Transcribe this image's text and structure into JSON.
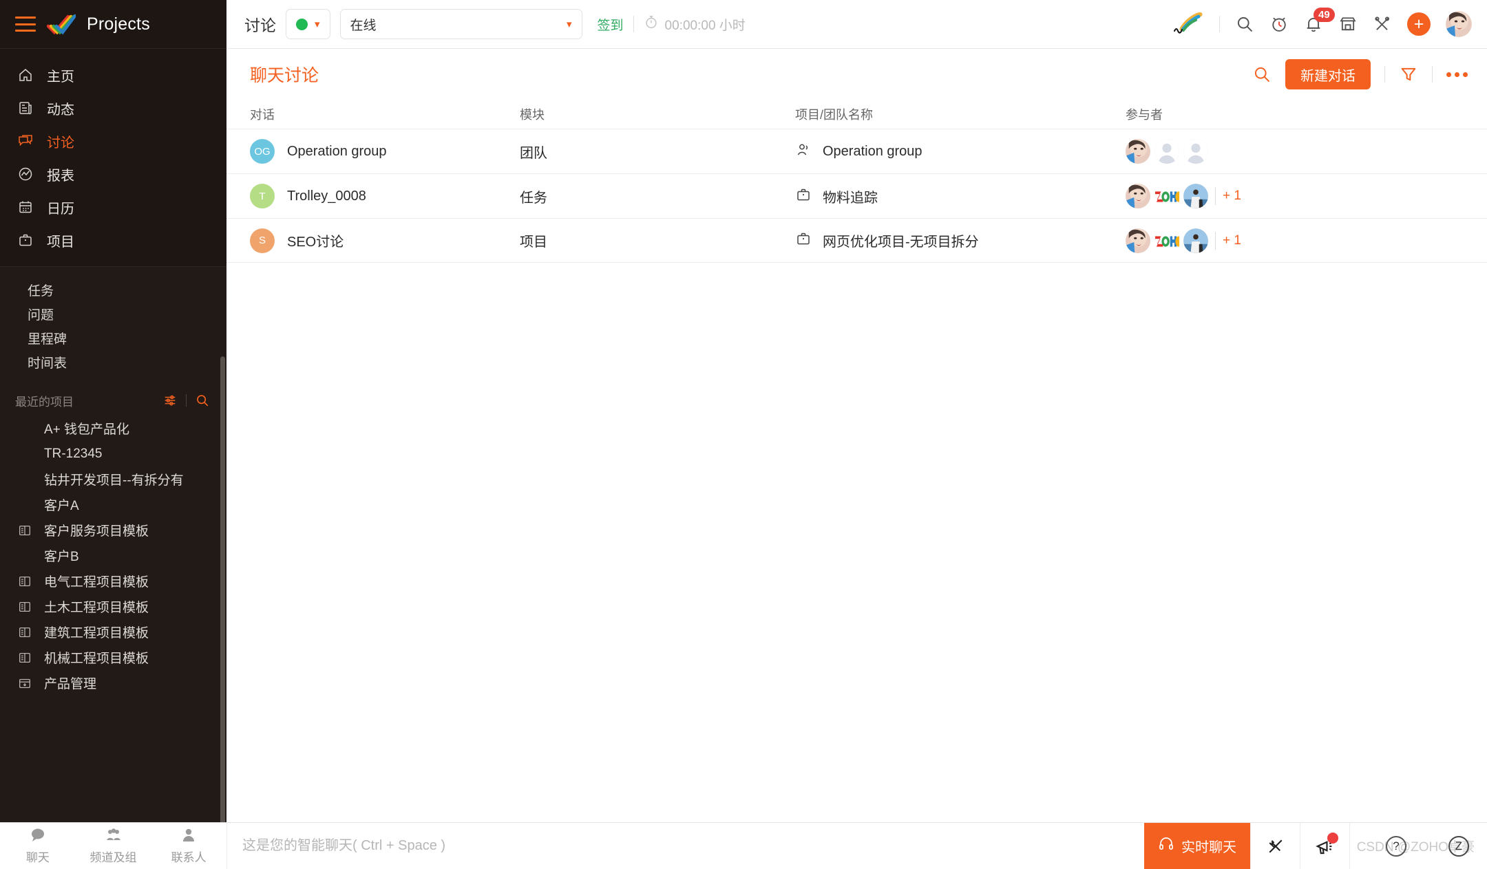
{
  "sidebar": {
    "brand": "Projects",
    "hamburger_icon": "hamburger-menu-icon",
    "logo_icon": "zoho-projects-checkmark-logo",
    "nav": [
      {
        "label": "主页",
        "icon": "home-icon",
        "active": false
      },
      {
        "label": "动态",
        "icon": "feed-icon",
        "active": false
      },
      {
        "label": "讨论",
        "icon": "discussion-bubbles-icon",
        "active": true
      },
      {
        "label": "报表",
        "icon": "report-chart-icon",
        "active": false
      },
      {
        "label": "日历",
        "icon": "calendar-icon",
        "active": false
      },
      {
        "label": "项目",
        "icon": "briefcase-icon",
        "active": false
      }
    ],
    "sub_items": [
      {
        "label": "任务"
      },
      {
        "label": "问题"
      },
      {
        "label": "里程碑"
      },
      {
        "label": "时间表"
      }
    ],
    "recent_section": {
      "title": "最近的项目",
      "settings_icon": "sliders-icon",
      "search_icon": "search-icon"
    },
    "projects": [
      {
        "label": "A+ 钱包产品化",
        "icon": null
      },
      {
        "label": "TR-12345",
        "icon": null
      },
      {
        "label": "钻井开发项目--有拆分有",
        "icon": null
      },
      {
        "label": "客户A",
        "icon": null
      },
      {
        "label": "客户服务项目模板",
        "icon": "template-icon"
      },
      {
        "label": "客户B",
        "icon": null
      },
      {
        "label": "电气工程项目模板",
        "icon": "template-icon"
      },
      {
        "label": "土木工程项目模板",
        "icon": "template-icon"
      },
      {
        "label": "建筑工程项目模板",
        "icon": "template-icon"
      },
      {
        "label": "机械工程项目模板",
        "icon": "template-icon"
      },
      {
        "label": "产品管理",
        "icon": "archive-icon"
      }
    ],
    "bottom_tabs": [
      {
        "label": "聊天",
        "icon": "chat-bubble-icon"
      },
      {
        "label": "频道及组",
        "icon": "group-people-icon"
      },
      {
        "label": "联系人",
        "icon": "contact-person-icon"
      }
    ]
  },
  "topbar": {
    "page_label": "讨论",
    "status_dot_color": "#20b954",
    "status_value": "在线",
    "checkin_label": "签到",
    "timer_icon": "stopwatch-icon",
    "timer_value": "00:00:00 小时",
    "icons": {
      "quill": "feather-quill-icon",
      "search": "search-icon",
      "alarm": "alarm-clock-icon",
      "bell": "notification-bell-icon",
      "bell_badge": "49",
      "marketplace": "marketplace-store-icon",
      "tools": "tools-wrench-icon",
      "add": "plus-icon",
      "avatar": "user-avatar"
    }
  },
  "content": {
    "title": "聊天讨论",
    "search_icon": "search-icon",
    "new_chat_label": "新建对话",
    "filter_icon": "funnel-filter-icon",
    "more_icon": "more-options-icon",
    "columns": [
      "对话",
      "模块",
      "项目/团队名称",
      "参与者"
    ],
    "rows": [
      {
        "avatar_initials": "OG",
        "avatar_color": "#6cc6e0",
        "name": "Operation group",
        "module": "团队",
        "project_icon": "team-people-icon",
        "project": "Operation group",
        "participants": [
          "photo-woman",
          "default-user",
          "default-user"
        ],
        "extra_count": ""
      },
      {
        "avatar_initials": "T",
        "avatar_color": "#b4dd85",
        "name": "Trolley_0008",
        "module": "任务",
        "project_icon": "briefcase-icon",
        "project": "物料追踪",
        "participants": [
          "photo-woman",
          "zoho-logo",
          "photo-man"
        ],
        "extra_count": "+ 1"
      },
      {
        "avatar_initials": "S",
        "avatar_color": "#f0a46c",
        "name": "SEO讨论",
        "module": "项目",
        "project_icon": "briefcase-icon",
        "project": "网页优化项目-无项目拆分",
        "participants": [
          "photo-woman",
          "zoho-logo",
          "photo-man"
        ],
        "extra_count": "+ 1"
      }
    ]
  },
  "bottombar": {
    "chat_placeholder": "这是您的智能聊天( Ctrl + Space )",
    "live_chat_label": "实时聊天",
    "live_chat_icon": "headset-icon",
    "plug_icon": "plug-disconnected-icon",
    "megaphone_icon": "megaphone-icon",
    "watermark": "CSDN @ZOHO卓豪",
    "help_icon": "help-question-icon",
    "z_icon": "zoho-z-icon"
  },
  "theme": {
    "accent": "#f4601f",
    "sidebar_bg": "#1d1612",
    "green": "#20b954",
    "badge_red": "#e8423a"
  }
}
